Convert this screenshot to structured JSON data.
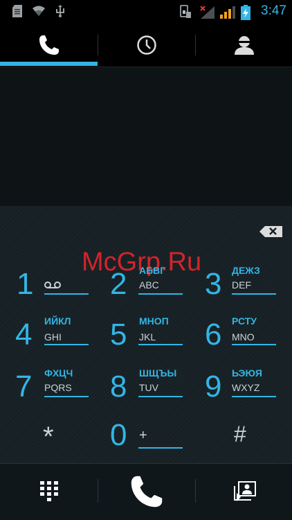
{
  "status_bar": {
    "time": "3:47",
    "icons": [
      "sd-card-icon",
      "wifi-icon",
      "usb-icon",
      "sim-card-icon",
      "signal-no-service-icon",
      "signal-icon",
      "battery-charging-icon"
    ]
  },
  "tabs": [
    {
      "name": "tab-dialer",
      "icon": "phone-icon",
      "selected": true
    },
    {
      "name": "tab-call-log",
      "icon": "clock-icon",
      "selected": false
    },
    {
      "name": "tab-contacts",
      "icon": "person-icon",
      "selected": false
    }
  ],
  "watermark": "McGrp.Ru",
  "keys": [
    {
      "digit": "1",
      "cyr": "",
      "lat": ""
    },
    {
      "digit": "2",
      "cyr": "АБВГ",
      "lat": "ABC"
    },
    {
      "digit": "3",
      "cyr": "ДЕЖЗ",
      "lat": "DEF"
    },
    {
      "digit": "4",
      "cyr": "ИЙКЛ",
      "lat": "GHI"
    },
    {
      "digit": "5",
      "cyr": "МНОП",
      "lat": "JKL"
    },
    {
      "digit": "6",
      "cyr": "РСТУ",
      "lat": "MNO"
    },
    {
      "digit": "7",
      "cyr": "ФХЦЧ",
      "lat": "PQRS"
    },
    {
      "digit": "8",
      "cyr": "ШЩЪЫ",
      "lat": "TUV"
    },
    {
      "digit": "9",
      "cyr": "ЬЭЮЯ",
      "lat": "WXYZ"
    },
    {
      "digit": "*",
      "cyr": "",
      "lat": ""
    },
    {
      "digit": "0",
      "cyr": "",
      "lat": "+"
    },
    {
      "digit": "#",
      "cyr": "",
      "lat": ""
    }
  ],
  "colors": {
    "accent": "#33b5e5",
    "background": "#000000",
    "keypad": "#162024"
  }
}
